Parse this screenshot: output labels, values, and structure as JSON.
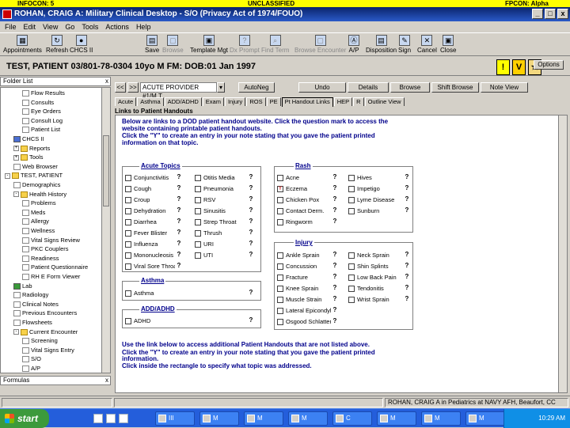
{
  "classification_bar": {
    "left": "INFOCON: 5",
    "center": "UNCLASSIFIED",
    "right": "FPCON: Alpha"
  },
  "window": {
    "title": "ROHAN, CRAIG A: Military Clinical Desktop - S/O (Privacy Act of 1974/FOUO)",
    "controls": [
      "_",
      "□",
      "x"
    ]
  },
  "menu": [
    "File",
    "Edit",
    "View",
    "Go",
    "Tools",
    "Actions",
    "Help"
  ],
  "toolbar": {
    "left": [
      {
        "label": "Appointments",
        "glyph": "▦"
      },
      {
        "label": "Refresh",
        "glyph": "↻"
      },
      {
        "label": "CHCS II",
        "glyph": "●"
      }
    ],
    "right": [
      {
        "label": "Save",
        "glyph": "▤",
        "enabled": true
      },
      {
        "label": "Browse",
        "glyph": "▢",
        "enabled": false
      },
      {
        "label": "Template Mgt",
        "glyph": "▣",
        "enabled": true
      },
      {
        "label": "Dx Prompt",
        "glyph": "?",
        "enabled": false
      },
      {
        "label": "Find Term",
        "glyph": "⌕",
        "enabled": false
      },
      {
        "label": "Browse Encounter",
        "glyph": "▢",
        "enabled": false
      },
      {
        "label": "A/P",
        "glyph": "Ⓐ",
        "enabled": true
      },
      {
        "label": "Disposition",
        "glyph": "▤",
        "enabled": true
      },
      {
        "label": "Sign",
        "glyph": "✎",
        "enabled": true
      },
      {
        "label": "Cancel",
        "glyph": "✕",
        "enabled": true
      },
      {
        "label": "Close",
        "glyph": "▣",
        "enabled": true
      }
    ]
  },
  "patient": {
    "banner": "TEST, PATIENT   03/801-78-0304  10yo  M   FM:   DOB:01 Jan 1997",
    "icons": [
      "!",
      "V",
      "★"
    ],
    "options_label": "Options"
  },
  "folder_list": {
    "header": "Folder List",
    "close": "x",
    "items": [
      {
        "label": "Flow Results",
        "level": 3,
        "icon": "doc"
      },
      {
        "label": "Consults",
        "level": 3,
        "icon": "doc"
      },
      {
        "label": "Eye Orders",
        "level": 3,
        "icon": "doc"
      },
      {
        "label": "Consult Log",
        "level": 3,
        "icon": "doc"
      },
      {
        "label": "Patient List",
        "level": 3,
        "icon": "doc"
      },
      {
        "label": "CHCS II",
        "level": 2,
        "icon": "blue"
      },
      {
        "label": "Reports",
        "level": 2,
        "icon": "folder",
        "expander": "+"
      },
      {
        "label": "Tools",
        "level": 2,
        "icon": "folder",
        "expander": "+"
      },
      {
        "label": "Web Browser",
        "level": 2,
        "icon": "doc"
      },
      {
        "label": "TEST, PATIENT",
        "level": 1,
        "icon": "folder",
        "expander": "-"
      },
      {
        "label": "Demographics",
        "level": 2,
        "icon": "doc"
      },
      {
        "label": "Health History",
        "level": 2,
        "icon": "folder",
        "expander": "-"
      },
      {
        "label": "Problems",
        "level": 3,
        "icon": "doc"
      },
      {
        "label": "Meds",
        "level": 3,
        "icon": "doc"
      },
      {
        "label": "Allergy",
        "level": 3,
        "icon": "doc"
      },
      {
        "label": "Wellness",
        "level": 3,
        "icon": "doc"
      },
      {
        "label": "Vital Signs Review",
        "level": 3,
        "icon": "doc"
      },
      {
        "label": "PKC Couplers",
        "level": 3,
        "icon": "doc"
      },
      {
        "label": "Readiness",
        "level": 3,
        "icon": "doc"
      },
      {
        "label": "Patient Questionnaire",
        "level": 3,
        "icon": "doc"
      },
      {
        "label": "RH E Form Viewer",
        "level": 3,
        "icon": "doc"
      },
      {
        "label": "Lab",
        "level": 2,
        "icon": "green"
      },
      {
        "label": "Radiology",
        "level": 2,
        "icon": "doc"
      },
      {
        "label": "Clinical Notes",
        "level": 2,
        "icon": "doc"
      },
      {
        "label": "Previous Encounters",
        "level": 2,
        "icon": "doc"
      },
      {
        "label": "Flowsheets",
        "level": 2,
        "icon": "doc"
      },
      {
        "label": "Current Encounter",
        "level": 2,
        "icon": "folder",
        "expander": "-"
      },
      {
        "label": "Screening",
        "level": 3,
        "icon": "doc"
      },
      {
        "label": "Vital Signs Entry",
        "level": 3,
        "icon": "doc"
      },
      {
        "label": "S/O",
        "level": 3,
        "icon": "doc"
      },
      {
        "label": "A/P",
        "level": 3,
        "icon": "doc"
      }
    ]
  },
  "formulas": {
    "header": "Formulas",
    "close": "x"
  },
  "provider_bar": {
    "prev": "<<",
    "next": ">>",
    "provider": "ACUTE PROVIDER #1/M.T",
    "dropdown": "▾",
    "buttons": [
      "AutoNeg",
      "Undo",
      "Details",
      "Browse",
      "Shift Browse",
      "Note View"
    ]
  },
  "tabs": [
    "Acute",
    "Asthma",
    "ADD/ADHD",
    "Exam",
    "Injury",
    "ROS",
    "PE",
    "Pt Handout Links",
    "HEP",
    "R",
    "Outline View"
  ],
  "active_tab": "Pt Handout Links",
  "section_label": "Links to Patient Handouts",
  "instructions_top": [
    "Below are links to a DOD patient handout website. Click the question mark to access the",
    "website containing printable patient handouts.",
    "Click the \"Y\" to create an entry in your note stating that you gave the patient printed",
    "information on that topic."
  ],
  "instructions_bottom": [
    "Use the link below to access additional Patient Handouts that are not listed above.",
    "Click the \"Y\" to create an entry in your note stating that you gave the patient printed",
    "information.",
    "Click inside the rectangle to specify what topic was addressed."
  ],
  "groups": {
    "acute": {
      "title": "Acute Topics",
      "col1": [
        "Conjunctivitis",
        "Cough",
        "Croup",
        "Dehydration",
        "Diarrhea",
        "Fever Blister",
        "Influenza",
        "Mononucleosis",
        "Viral Sore Throat"
      ],
      "col2": [
        "Otitis Media",
        "Pneumonia",
        "RSV",
        "Sinusitis",
        "Strep Throat",
        "Thrush",
        "URI",
        "UTI"
      ]
    },
    "asthma": {
      "title": "Asthma",
      "items": [
        "Asthma"
      ]
    },
    "add": {
      "title": "ADD/ADHD",
      "items": [
        "ADHD"
      ]
    },
    "rash": {
      "title": "Rash",
      "col1": [
        "Acne",
        "Eczema",
        "Chicken Pox",
        "Contact Derm.",
        "Ringworm"
      ],
      "col2": [
        "Hives",
        "Impetigo",
        "Lyme Disease",
        "Sunburn"
      ],
      "checked": [
        "Eczema"
      ]
    },
    "injury": {
      "title": "Injury",
      "col1": [
        "Ankle Sprain",
        "Concussion",
        "Fracture",
        "Knee Sprain",
        "Muscle Strain",
        "Lateral Epicondylitis",
        "Osgood Schlatter"
      ],
      "col2": [
        "Neck Sprain",
        "Shin Splints",
        "Low Back Pain",
        "Tendonitis",
        "Wrist Sprain"
      ]
    }
  },
  "status": {
    "user": "ROHAN, CRAIG A in Pediatrics at NAVY AFH, Beaufort, CC"
  },
  "taskbar": {
    "start": "start",
    "tasks": [
      "III",
      "M",
      "M",
      "M",
      "C",
      "M",
      "M",
      "M"
    ],
    "clock": "10:29 AM"
  }
}
